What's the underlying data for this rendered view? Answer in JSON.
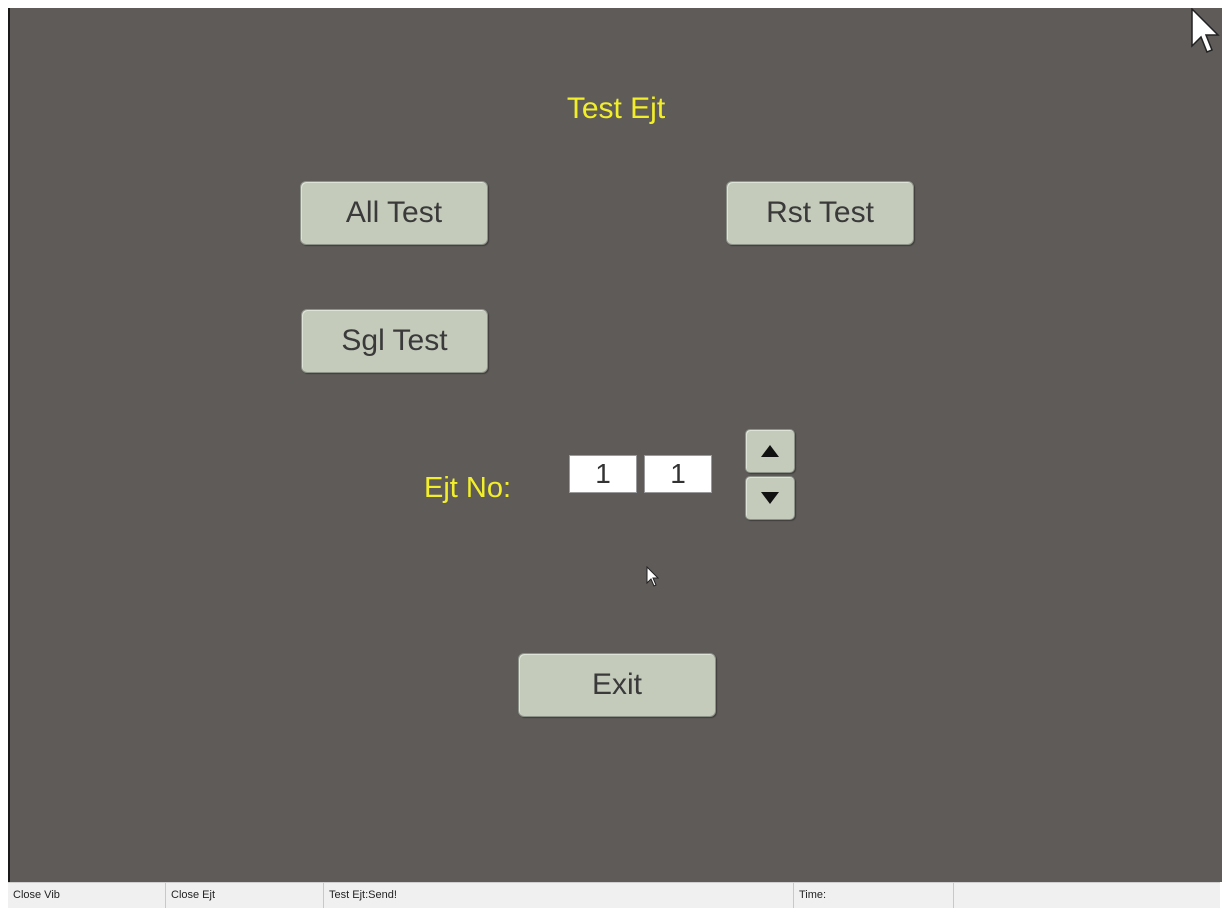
{
  "screen": {
    "title": "Test Ejt"
  },
  "buttons": {
    "all_test": "All Test",
    "rst_test": "Rst Test",
    "sgl_test": "Sgl Test",
    "exit": "Exit"
  },
  "ejector": {
    "label": "Ejt No:",
    "value_1": "1",
    "value_2": "1",
    "up_icon": "triangle-up-icon",
    "down_icon": "triangle-down-icon"
  },
  "statusbar": {
    "cell_1": "Close Vib",
    "cell_2": "Close Ejt",
    "cell_3": "Test Ejt:Send!",
    "cell_4": "Time:",
    "cell_5": ""
  },
  "colors": {
    "background": "#5f5b59",
    "title_text": "#f2ef2a",
    "button_face": "#c4cbbb",
    "statusbar": "#f0f0f0"
  }
}
